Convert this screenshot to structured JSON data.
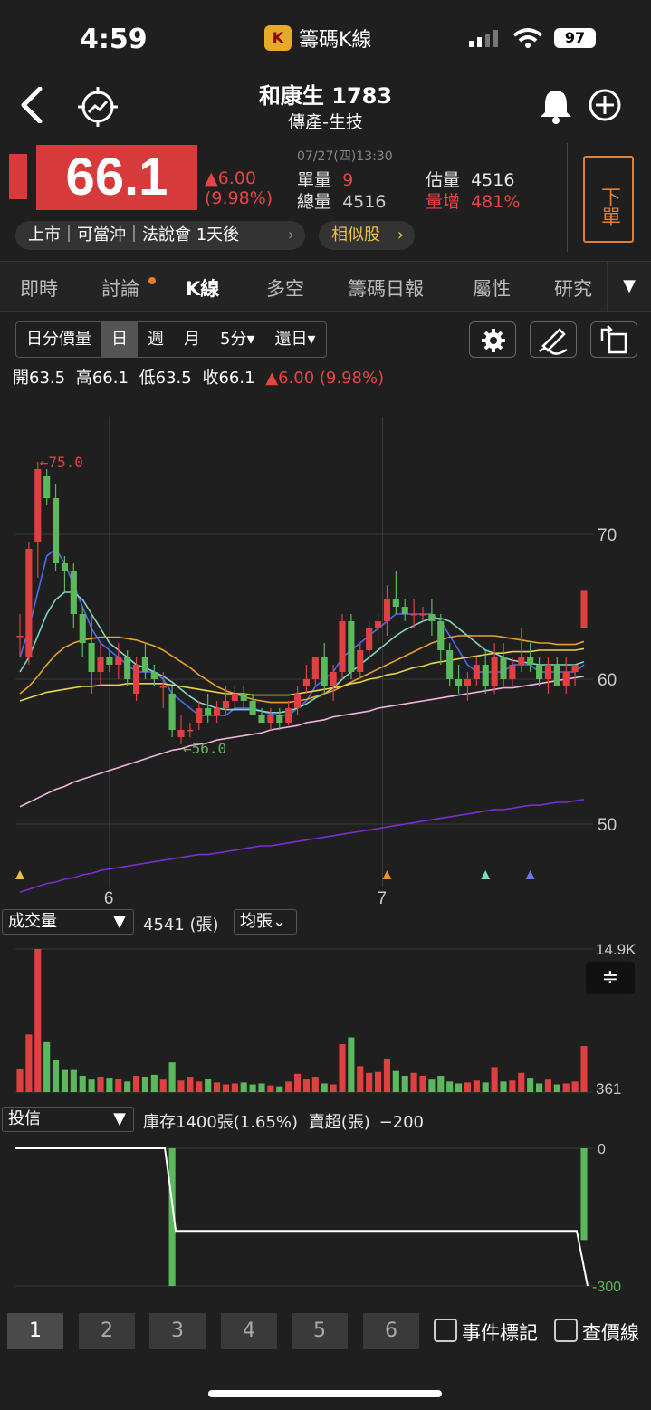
{
  "status_bar": {
    "time": "4:59",
    "app_name": "籌碼K線",
    "app_icon_letter": "K",
    "battery": "97"
  },
  "header": {
    "title": "和康生 1783",
    "subtitle": "傳產-生技",
    "back_icon": "back-icon",
    "alert_icon": "bell-icon",
    "add_icon": "plus-icon"
  },
  "quote": {
    "price": "66.1",
    "change": "▲6.00",
    "change_pct": "(9.98%)",
    "datetime": "07/27(四)13:30",
    "single_vol_label": "單量",
    "single_vol": "9",
    "total_vol_label": "總量",
    "total_vol": "4516",
    "est_vol_label": "估量",
    "est_vol": "4516",
    "vol_inc_label": "量增",
    "vol_inc": "481%",
    "order_button": "下單",
    "tags": "上市｜可當沖｜法說會 1天後",
    "similar_button": "相似股"
  },
  "tabs": [
    "即時",
    "討論",
    "K線",
    "多空",
    "籌碼日報",
    "屬性",
    "研究"
  ],
  "active_tab": "K線",
  "toolbar": {
    "items": [
      "日分價量",
      "日",
      "週",
      "月",
      "5分▾",
      "還日▾"
    ],
    "selected": "日"
  },
  "ohlc": {
    "open_label": "開",
    "open": "63.5",
    "high_label": "高",
    "high": "66.1",
    "low_label": "低",
    "low": "63.5",
    "close_label": "收",
    "close": "66.1",
    "change": "▲6.00 (9.98%)"
  },
  "chart_data": [
    {
      "type": "candlestick",
      "y_axis_ticks": [
        "70",
        "60",
        "50"
      ],
      "ylim": [
        45,
        80
      ],
      "x_axis_ticks": [
        "6",
        "7"
      ],
      "max_annotation": "←75.0",
      "min_annotation": "←56.0",
      "candles": [
        [
          63.0,
          64.5,
          61.5,
          63.0
        ],
        [
          61.5,
          69.5,
          61.0,
          69.0
        ],
        [
          69.5,
          75.0,
          67.0,
          74.5
        ],
        [
          74.0,
          74.5,
          72.0,
          72.5
        ],
        [
          72.5,
          73.5,
          67.5,
          68.0
        ],
        [
          68.0,
          68.5,
          66.0,
          67.5
        ],
        [
          67.5,
          68.0,
          63.5,
          64.5
        ],
        [
          64.5,
          65.0,
          61.5,
          62.5
        ],
        [
          62.5,
          64.5,
          59.0,
          60.5
        ],
        [
          60.5,
          62.5,
          59.5,
          61.5
        ],
        [
          61.5,
          62.0,
          60.5,
          61.0
        ],
        [
          61.0,
          62.5,
          60.0,
          61.5
        ],
        [
          61.5,
          62.0,
          59.5,
          60.0
        ],
        [
          59.0,
          61.5,
          58.5,
          61.0
        ],
        [
          61.5,
          62.5,
          60.0,
          60.5
        ],
        [
          60.5,
          61.0,
          59.5,
          60.0
        ],
        [
          59.5,
          60.5,
          58.0,
          59.5
        ],
        [
          59.0,
          59.5,
          56.0,
          56.5
        ],
        [
          56.0,
          57.5,
          55.5,
          56.5
        ],
        [
          56.5,
          57.0,
          56.0,
          56.5
        ],
        [
          57.0,
          58.5,
          56.5,
          58.0
        ],
        [
          58.0,
          59.0,
          57.0,
          57.5
        ],
        [
          57.5,
          58.5,
          57.0,
          58.0
        ],
        [
          58.0,
          59.5,
          57.5,
          58.5
        ],
        [
          58.5,
          59.5,
          58.0,
          59.0
        ],
        [
          59.0,
          59.5,
          58.0,
          58.5
        ],
        [
          58.5,
          59.0,
          57.5,
          57.5
        ],
        [
          57.5,
          58.0,
          57.0,
          57.0
        ],
        [
          57.0,
          58.0,
          56.5,
          57.5
        ],
        [
          57.5,
          58.0,
          56.5,
          57.0
        ],
        [
          57.0,
          58.5,
          56.8,
          58.0
        ],
        [
          58.0,
          59.5,
          57.5,
          59.0
        ],
        [
          59.5,
          61.0,
          59.0,
          60.0
        ],
        [
          60.0,
          61.5,
          59.5,
          61.5
        ],
        [
          61.5,
          62.5,
          59.0,
          59.5
        ],
        [
          59.5,
          61.0,
          58.5,
          60.5
        ],
        [
          60.5,
          64.5,
          60.0,
          64.0
        ],
        [
          64.0,
          64.5,
          60.0,
          60.5
        ],
        [
          60.5,
          62.5,
          60.0,
          62.0
        ],
        [
          62.0,
          64.0,
          61.5,
          63.5
        ],
        [
          63.5,
          64.5,
          62.5,
          64.0
        ],
        [
          64.0,
          66.5,
          63.0,
          65.5
        ],
        [
          65.5,
          67.5,
          64.5,
          65.0
        ],
        [
          65.0,
          65.5,
          64.0,
          64.5
        ],
        [
          64.5,
          65.5,
          63.5,
          64.5
        ],
        [
          64.5,
          65.0,
          64.0,
          64.5
        ],
        [
          64.5,
          65.5,
          63.0,
          64.0
        ],
        [
          64.0,
          64.5,
          61.0,
          62.0
        ],
        [
          62.0,
          62.5,
          59.5,
          60.0
        ],
        [
          60.0,
          61.0,
          59.0,
          59.5
        ],
        [
          59.5,
          60.5,
          58.5,
          60.0
        ],
        [
          60.0,
          61.5,
          59.5,
          61.0
        ],
        [
          61.0,
          62.0,
          59.0,
          59.5
        ],
        [
          59.5,
          62.5,
          59.0,
          61.5
        ],
        [
          61.5,
          62.5,
          59.5,
          60.0
        ],
        [
          60.0,
          61.5,
          59.5,
          61.0
        ],
        [
          61.0,
          63.5,
          60.5,
          61.5
        ],
        [
          61.5,
          62.5,
          60.5,
          61.0
        ],
        [
          61.0,
          61.5,
          59.5,
          60.0
        ],
        [
          60.0,
          61.5,
          59.0,
          61.0
        ],
        [
          61.0,
          61.5,
          59.5,
          59.5
        ],
        [
          59.5,
          61.5,
          59.0,
          60.5
        ],
        [
          60.5,
          61.0,
          59.5,
          61.0
        ],
        [
          63.5,
          66.1,
          63.5,
          66.1
        ]
      ],
      "moving_averages": [
        {
          "color": "#4a6cf0",
          "values": [
            61.5,
            63.5,
            66.0,
            68.5,
            69.0,
            68.0,
            66.5,
            65.0,
            63.5,
            62.5,
            62.0,
            61.5,
            61.0,
            60.5,
            60.5,
            60.5,
            60.0,
            59.0,
            58.5,
            58.0,
            57.5,
            57.5,
            57.5,
            57.5,
            58.0,
            58.0,
            58.0,
            57.8,
            57.6,
            57.5,
            57.5,
            58.0,
            58.5,
            59.5,
            60.0,
            60.5,
            61.5,
            62.0,
            62.5,
            63.0,
            63.5,
            64.0,
            64.5,
            64.5,
            64.5,
            64.5,
            64.5,
            64.0,
            63.0,
            62.0,
            61.0,
            60.5,
            60.5,
            60.5,
            60.5,
            61.0,
            61.0,
            61.0,
            60.5,
            60.5,
            60.5,
            60.5,
            60.5,
            61.0
          ]
        },
        {
          "color": "#7fd7c4",
          "values": [
            60.5,
            61.5,
            63.0,
            64.5,
            65.5,
            66.0,
            66.0,
            65.5,
            64.5,
            63.5,
            62.5,
            62.0,
            61.5,
            61.0,
            60.8,
            60.5,
            60.2,
            59.8,
            59.3,
            58.8,
            58.4,
            58.2,
            58.0,
            57.9,
            57.9,
            57.9,
            57.9,
            57.8,
            57.7,
            57.7,
            57.8,
            58.0,
            58.3,
            58.7,
            59.0,
            59.4,
            60.0,
            60.5,
            61.0,
            61.5,
            62.0,
            62.5,
            63.0,
            63.4,
            63.7,
            64.0,
            64.2,
            64.2,
            64.0,
            63.5,
            63.0,
            62.5,
            62.0,
            61.8,
            61.5,
            61.3,
            61.2,
            61.1,
            61.0,
            61.0,
            61.0,
            61.0,
            61.0,
            61.2
          ]
        },
        {
          "color": "#e8a030",
          "values": [
            59.0,
            59.5,
            60.2,
            61.0,
            61.7,
            62.2,
            62.5,
            62.7,
            62.8,
            62.9,
            62.9,
            62.9,
            62.8,
            62.7,
            62.5,
            62.3,
            62.0,
            61.6,
            61.2,
            60.8,
            60.3,
            59.9,
            59.5,
            59.2,
            59.0,
            58.8,
            58.6,
            58.5,
            58.4,
            58.4,
            58.4,
            58.5,
            58.6,
            58.8,
            59.0,
            59.2,
            59.5,
            59.8,
            60.1,
            60.4,
            60.7,
            61.0,
            61.3,
            61.6,
            61.9,
            62.2,
            62.5,
            62.7,
            62.9,
            63.0,
            63.0,
            63.0,
            63.0,
            63.0,
            62.9,
            62.8,
            62.7,
            62.6,
            62.5,
            62.5,
            62.4,
            62.4,
            62.4,
            62.6
          ]
        },
        {
          "color": "#e8d24a",
          "values": [
            58.5,
            58.7,
            58.9,
            59.1,
            59.2,
            59.3,
            59.4,
            59.5,
            59.5,
            59.6,
            59.6,
            59.6,
            59.7,
            59.7,
            59.7,
            59.7,
            59.7,
            59.6,
            59.5,
            59.4,
            59.3,
            59.2,
            59.1,
            59.0,
            59.0,
            59.0,
            58.9,
            58.9,
            58.9,
            58.9,
            58.9,
            59.0,
            59.1,
            59.2,
            59.3,
            59.4,
            59.5,
            59.7,
            59.8,
            60.0,
            60.1,
            60.3,
            60.4,
            60.6,
            60.8,
            60.9,
            61.1,
            61.2,
            61.3,
            61.4,
            61.5,
            61.6,
            61.7,
            61.8,
            61.8,
            61.9,
            61.9,
            61.9,
            62.0,
            62.0,
            62.0,
            62.0,
            62.0,
            62.1
          ]
        },
        {
          "color": "#f0b4e0",
          "values": [
            51.2,
            51.5,
            51.8,
            52.1,
            52.4,
            52.6,
            52.9,
            53.1,
            53.3,
            53.5,
            53.7,
            53.9,
            54.1,
            54.3,
            54.5,
            54.7,
            54.9,
            55.1,
            55.2,
            55.4,
            55.5,
            55.6,
            55.8,
            55.9,
            56.0,
            56.1,
            56.2,
            56.3,
            56.5,
            56.6,
            56.7,
            56.8,
            57.0,
            57.1,
            57.2,
            57.4,
            57.5,
            57.6,
            57.7,
            57.8,
            58.0,
            58.1,
            58.2,
            58.3,
            58.4,
            58.5,
            58.6,
            58.7,
            58.8,
            58.9,
            59.0,
            59.1,
            59.2,
            59.3,
            59.4,
            59.4,
            59.5,
            59.6,
            59.7,
            59.8,
            59.9,
            60.0,
            60.1,
            60.2
          ]
        },
        {
          "color": "#7a2fd0",
          "values": [
            45.3,
            45.5,
            45.7,
            45.9,
            46.0,
            46.2,
            46.3,
            46.5,
            46.6,
            46.8,
            46.9,
            47.0,
            47.1,
            47.2,
            47.3,
            47.4,
            47.5,
            47.6,
            47.7,
            47.8,
            47.9,
            47.9,
            48.0,
            48.1,
            48.2,
            48.3,
            48.4,
            48.5,
            48.5,
            48.6,
            48.7,
            48.8,
            48.9,
            49.0,
            49.1,
            49.2,
            49.3,
            49.4,
            49.5,
            49.6,
            49.7,
            49.8,
            49.9,
            50.0,
            50.1,
            50.2,
            50.3,
            50.4,
            50.5,
            50.6,
            50.7,
            50.8,
            50.9,
            51.0,
            51.0,
            51.1,
            51.2,
            51.3,
            51.3,
            51.4,
            51.5,
            51.5,
            51.6,
            51.7
          ]
        }
      ],
      "event_markers": [
        {
          "index": 0,
          "color": "#e8c04a"
        },
        {
          "index": 41,
          "color": "#e89030"
        },
        {
          "index": 52,
          "color": "#7fd7c4"
        },
        {
          "index": 57,
          "color": "#6a7cf0"
        }
      ]
    },
    {
      "type": "bar",
      "title": "成交量",
      "value_label": "4541 (張)",
      "ma_button": "均張⌄",
      "y_axis_ticks": [
        "14.9K",
        "361"
      ],
      "ylim": [
        0,
        14900
      ],
      "values": [
        2400,
        6000,
        14900,
        5200,
        3400,
        2300,
        2300,
        1700,
        1300,
        1600,
        1500,
        1400,
        1100,
        1700,
        1600,
        1800,
        1300,
        3100,
        1200,
        1600,
        1100,
        1400,
        1000,
        800,
        900,
        1000,
        800,
        900,
        700,
        600,
        1100,
        1900,
        1400,
        1600,
        900,
        800,
        5000,
        5700,
        2700,
        2000,
        2100,
        3500,
        2200,
        1700,
        2000,
        1700,
        1300,
        1700,
        1100,
        900,
        1000,
        1200,
        1000,
        2600,
        1100,
        1200,
        2000,
        1500,
        900,
        1300,
        800,
        900,
        1100,
        4800
      ],
      "colors": "up/down follow candles"
    },
    {
      "type": "bar",
      "title": "投信",
      "info": "庫存1400張(1.65%)",
      "net_label": "賣超(張)",
      "net_value": "−200",
      "y_axis_ticks": [
        "0",
        "-300"
      ],
      "ylim": [
        -300,
        0
      ],
      "bars": [
        {
          "index": 17,
          "value": -300
        },
        {
          "index": 63,
          "value": -200
        }
      ],
      "inventory_line": "flat, step down at 6th-day-of-month boundary, step down at end"
    }
  ],
  "bottom_bar": {
    "buttons": [
      "1",
      "2",
      "3",
      "4",
      "5",
      "6"
    ],
    "selected": "1",
    "checkbox1": "事件標記",
    "checkbox2": "查價線"
  }
}
